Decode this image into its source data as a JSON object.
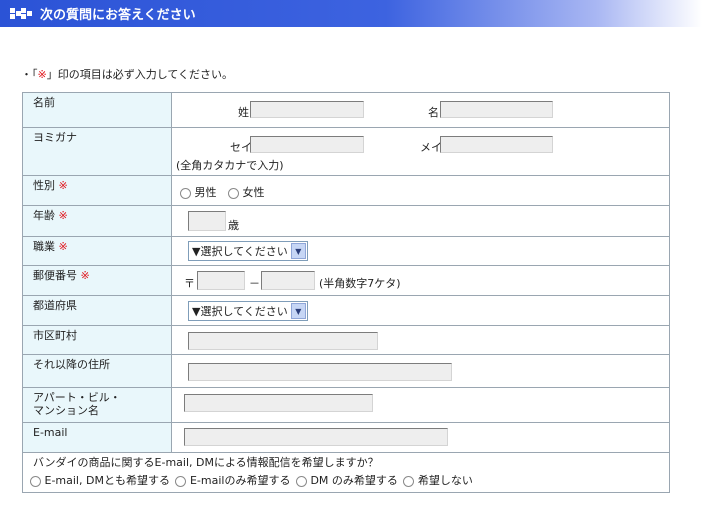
{
  "header": {
    "title": "次の質問にお答えください"
  },
  "note": {
    "prefix": "・「",
    "mark": "※",
    "suffix": "」印の項目は必ず入力してください。"
  },
  "required_mark": "※",
  "fields": {
    "name": {
      "label": "名前",
      "sei_label": "姓",
      "mei_label": "名",
      "sei_value": "",
      "mei_value": ""
    },
    "kana": {
      "label": "ヨミガナ",
      "sei_label": "セイ",
      "mei_label": "メイ",
      "hint": "(全角カタカナで入力)",
      "sei_value": "",
      "mei_value": ""
    },
    "gender": {
      "label": "性別",
      "options": [
        "男性",
        "女性"
      ]
    },
    "age": {
      "label": "年齢",
      "unit": "歳",
      "value": ""
    },
    "job": {
      "label": "職業",
      "selected": "▼選択してください"
    },
    "postal": {
      "label": "郵便番号",
      "prefix": "〒",
      "dash": "－",
      "hint": "(半角数字7ケタ)",
      "first": "",
      "second": ""
    },
    "prefecture": {
      "label": "都道府県",
      "selected": "▼選択してください"
    },
    "city": {
      "label": "市区町村",
      "value": ""
    },
    "address": {
      "label": "それ以降の住所",
      "value": ""
    },
    "building": {
      "label_line1": "アパート・ビル・",
      "label_line2": "マンション名",
      "value": ""
    },
    "email": {
      "label": "E-mail",
      "value": ""
    }
  },
  "newsletter": {
    "question": "バンダイの商品に関するE-mail, DMによる情報配信を希望しますか？",
    "options": [
      "E-mail, DMとも希望する",
      "E-mailのみ希望する",
      "DM のみ希望する",
      "希望しない"
    ]
  }
}
